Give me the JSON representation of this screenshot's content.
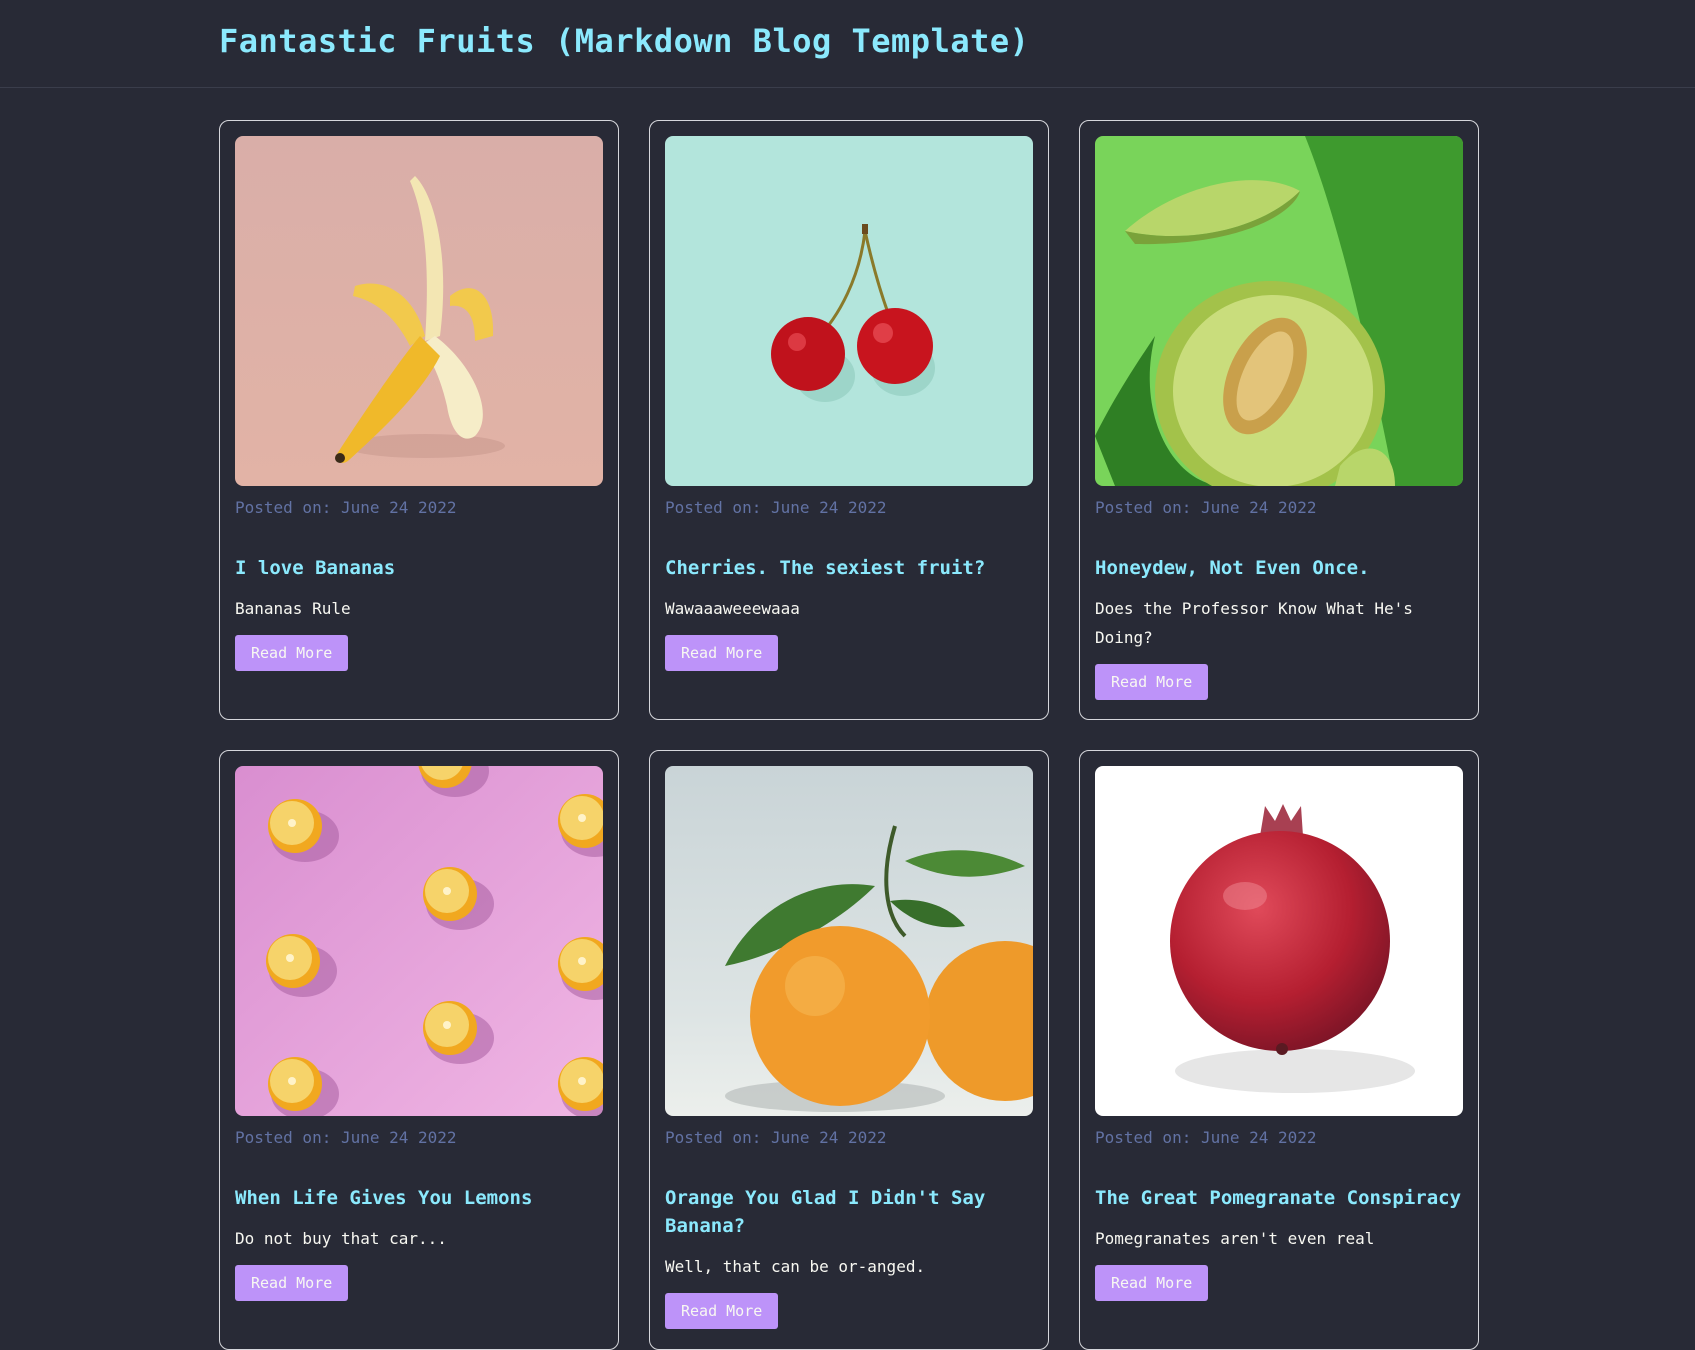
{
  "site": {
    "title": "Fantastic Fruits (Markdown Blog Template)"
  },
  "posts": [
    {
      "date": "Posted on: June 24 2022",
      "title": "I love Bananas",
      "description": "Bananas Rule",
      "button": "Read More",
      "image": "banana-photo"
    },
    {
      "date": "Posted on: June 24 2022",
      "title": "Cherries. The sexiest fruit?",
      "description": "Wawaaaweeewaaa",
      "button": "Read More",
      "image": "cherries-photo"
    },
    {
      "date": "Posted on: June 24 2022",
      "title": "Honeydew, Not Even Once.",
      "description": "Does the Professor Know What He's Doing?",
      "button": "Read More",
      "image": "melon-photo"
    },
    {
      "date": "Posted on: June 24 2022",
      "title": "When Life Gives You Lemons",
      "description": "Do not buy that car...",
      "button": "Read More",
      "image": "lemons-photo"
    },
    {
      "date": "Posted on: June 24 2022",
      "title": "Orange You Glad I Didn't Say Banana?",
      "description": "Well, that can be or-anged.",
      "button": "Read More",
      "image": "oranges-photo"
    },
    {
      "date": "Posted on: June 24 2022",
      "title": "The Great Pomegranate Conspiracy",
      "description": "Pomegranates aren't even real",
      "button": "Read More",
      "image": "pomegranate-photo"
    }
  ],
  "colors": {
    "background": "#282a36",
    "title": "#8be9fd",
    "date": "#6272a4",
    "text": "#f8f8f2",
    "button": "#bd93f9"
  }
}
